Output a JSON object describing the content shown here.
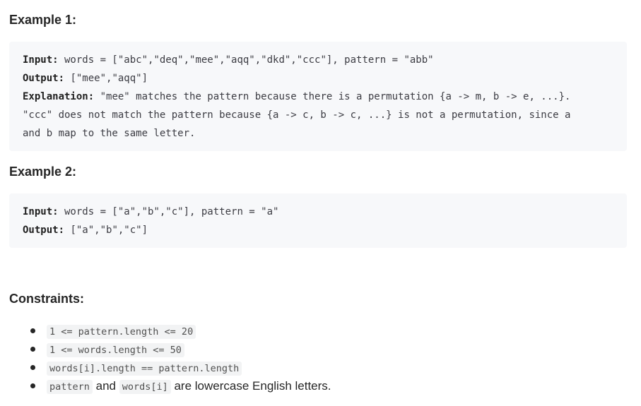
{
  "example1": {
    "title": "Example 1:",
    "input_label": "Input:",
    "input_value": " words = [\"abc\",\"deq\",\"mee\",\"aqq\",\"dkd\",\"ccc\"], pattern = \"abb\"",
    "output_label": "Output:",
    "output_value": " [\"mee\",\"aqq\"]",
    "explanation_label": "Explanation:",
    "explanation_line1": " \"mee\" matches the pattern because there is a permutation {a -> m, b -> e, ...}.",
    "explanation_line2": "\"ccc\" does not match the pattern because {a -> c, b -> c, ...} is not a permutation, since a",
    "explanation_line3": "and b map to the same letter."
  },
  "example2": {
    "title": "Example 2:",
    "input_label": "Input:",
    "input_value": " words = [\"a\",\"b\",\"c\"], pattern = \"a\"",
    "output_label": "Output:",
    "output_value": " [\"a\",\"b\",\"c\"]"
  },
  "constraints": {
    "title": "Constraints:",
    "item1_code": "1 <= pattern.length <= 20",
    "item2_code": "1 <= words.length <= 50",
    "item3_code": "words[i].length == pattern.length",
    "item4_code1": "pattern",
    "item4_text1": " and ",
    "item4_code2": "words[i]",
    "item4_text2": " are lowercase English letters."
  }
}
